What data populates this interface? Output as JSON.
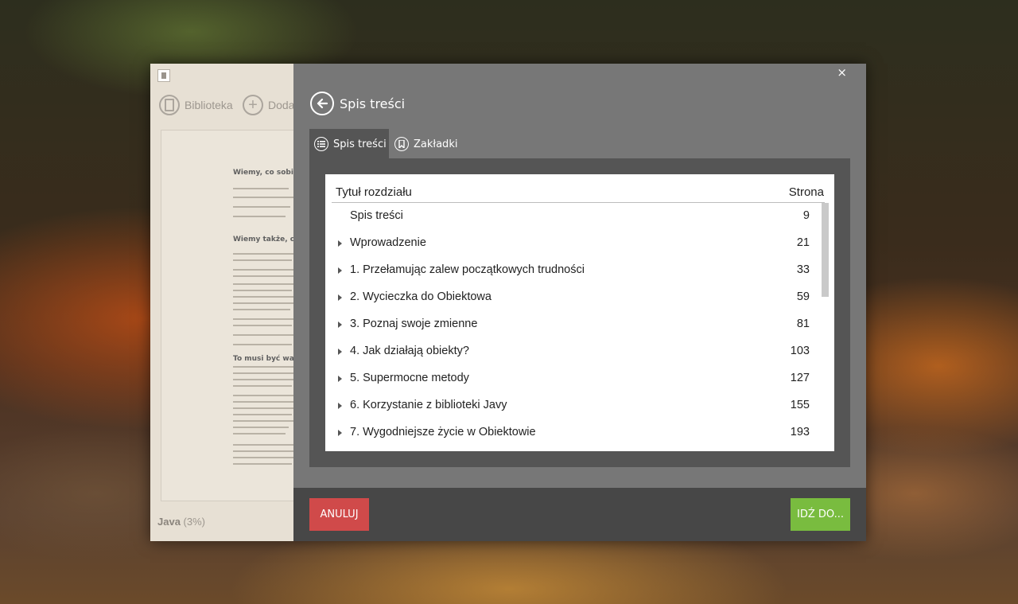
{
  "sidebar": {
    "toolbar": {
      "library_label": "Biblioteka",
      "add_label": "Doda"
    },
    "status": {
      "book": "Java",
      "progress": "(3%)"
    },
    "page_preview": {
      "heading1": "Wiemy, co sobie m",
      "heading2": "Wiemy także, co s",
      "heading3": "To musi być ważne!"
    }
  },
  "dialog": {
    "close_glyph": "×",
    "title": "Spis treści",
    "tabs": [
      {
        "label": "Spis treści",
        "active": true
      },
      {
        "label": "Zakładki",
        "active": false
      }
    ],
    "table": {
      "header_title": "Tytuł rozdziału",
      "header_page": "Strona",
      "rows": [
        {
          "title": "Spis treści",
          "page": "9",
          "expandable": false
        },
        {
          "title": "Wprowadzenie",
          "page": "21",
          "expandable": true
        },
        {
          "title": "1. Przełamując zalew początkowych trudności",
          "page": "33",
          "expandable": true
        },
        {
          "title": "2. Wycieczka do Obiektowa",
          "page": "59",
          "expandable": true
        },
        {
          "title": "3. Poznaj swoje zmienne",
          "page": "81",
          "expandable": true
        },
        {
          "title": "4. Jak działają obiekty?",
          "page": "103",
          "expandable": true
        },
        {
          "title": "5. Supermocne metody",
          "page": "127",
          "expandable": true
        },
        {
          "title": "6. Korzystanie z biblioteki Javy",
          "page": "155",
          "expandable": true
        },
        {
          "title": "7. Wygodniejsze życie w Obiektowie",
          "page": "193",
          "expandable": true
        }
      ]
    },
    "buttons": {
      "cancel_label": "ANULUJ",
      "go_label": "IDŹ DO..."
    }
  },
  "colors": {
    "dialog_bg": "#777777",
    "panel_bg": "#555555",
    "footer_bg": "#474747",
    "cancel": "#d04a4a",
    "go": "#79bc3f"
  }
}
